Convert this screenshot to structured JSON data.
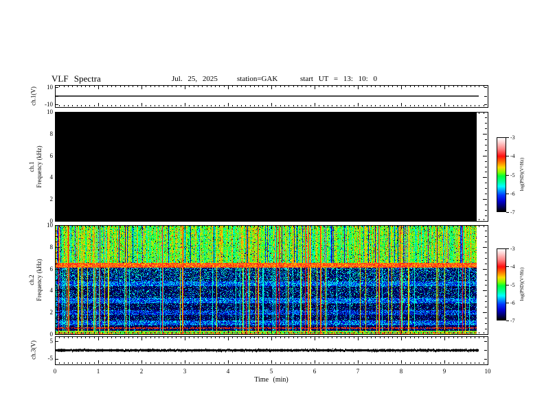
{
  "header": {
    "title": "VLF Spectra",
    "date": "Jul. 25, 2025",
    "station": "station=GAK",
    "start_ut": "start UT = 13: 10: 0"
  },
  "xaxis": {
    "label": "Time (min)",
    "ticks": [
      "0",
      "1",
      "2",
      "3",
      "4",
      "5",
      "6",
      "7",
      "8",
      "9",
      "10"
    ]
  },
  "panels": {
    "ch1v": {
      "label": "ch.1(V)",
      "yticks": [
        "10",
        "-10"
      ]
    },
    "ch1spec": {
      "label_line1": "ch.1",
      "label_line2": "Frequency (kHz)",
      "yticks": [
        "10",
        "8",
        "6",
        "4",
        "2",
        "0"
      ]
    },
    "ch2spec": {
      "label_line1": "ch.2",
      "label_line2": "Frequency (kHz)",
      "yticks": [
        "10",
        "8",
        "6",
        "4",
        "2",
        "0"
      ]
    },
    "ch3v": {
      "label": "ch.3(V)",
      "yticks": [
        "5",
        "-5"
      ]
    }
  },
  "colorbars": [
    {
      "label": "log(PSD)(V²/Hz)",
      "ticks": [
        "-3",
        "-4",
        "-5",
        "-6",
        "-7"
      ]
    },
    {
      "label": "log(PSD)(V²/Hz)",
      "ticks": [
        "-3",
        "-4",
        "-5",
        "-6",
        "-7"
      ]
    }
  ],
  "colors": {
    "scale": [
      [
        0,
        "#ffffff"
      ],
      [
        0.06,
        "#ffd2d2"
      ],
      [
        0.15,
        "#ff8484"
      ],
      [
        0.25,
        "#ff0e0e"
      ],
      [
        0.32,
        "#ff6a00"
      ],
      [
        0.4,
        "#ffd800"
      ],
      [
        0.47,
        "#7dff00"
      ],
      [
        0.52,
        "#00ff38"
      ],
      [
        0.6,
        "#00ff9c"
      ],
      [
        0.66,
        "#00ffff"
      ],
      [
        0.72,
        "#0096ff"
      ],
      [
        0.78,
        "#0038ff"
      ],
      [
        0.86,
        "#0000cf"
      ],
      [
        0.93,
        "#00006e"
      ],
      [
        1,
        "#000000"
      ]
    ],
    "frame": "#000000",
    "background": "#ffffff"
  },
  "chart_data": [
    {
      "type": "line",
      "name": "ch1_voltage",
      "ylabel": "ch.1(V)",
      "ylim": [
        -13,
        12.5
      ],
      "yticks": [
        10,
        -10
      ],
      "xlim": [
        0,
        10
      ],
      "x_extent": [
        0,
        9.8
      ],
      "series": [
        {
          "name": "ch.1",
          "y_constant": 0
        }
      ]
    },
    {
      "type": "heatmap",
      "name": "ch1_spectrogram",
      "ylabel": "ch.1 Frequency (kHz)",
      "ylim": [
        0,
        10
      ],
      "yticks": [
        0,
        2,
        4,
        6,
        8,
        10
      ],
      "xlim": [
        0,
        10
      ],
      "x_extent": [
        0,
        9.75
      ],
      "zlabel": "log(PSD)(V²/Hz)",
      "zlim": [
        -7,
        -3
      ],
      "uniform_level": -7
    },
    {
      "type": "heatmap",
      "name": "ch2_spectrogram",
      "ylabel": "ch.2 Frequency (kHz)",
      "ylim": [
        0,
        10
      ],
      "yticks": [
        0,
        2,
        4,
        6,
        8,
        10
      ],
      "xlim": [
        0,
        10
      ],
      "x_extent": [
        0,
        9.75
      ],
      "zlabel": "log(PSD)(V²/Hz)",
      "zlim": [
        -7,
        -3
      ],
      "bands": [
        {
          "f_range": [
            6.6,
            10.0
          ],
          "level": -4.95,
          "noise": 0.4,
          "kind": "bright"
        },
        {
          "f_range": [
            6.15,
            6.6
          ],
          "level": -4.2,
          "noise": 0.45,
          "kind": "bright"
        },
        {
          "f_range": [
            4.85,
            6.15
          ],
          "level": -6.6,
          "noise": 0.35,
          "kind": "dark",
          "dash_p": 0.38
        },
        {
          "f_range": [
            4.4,
            4.85
          ],
          "level": -6.05,
          "noise": 0.5,
          "kind": "mid"
        },
        {
          "f_range": [
            3.35,
            4.4
          ],
          "level": -6.65,
          "noise": 0.3,
          "kind": "dark",
          "dash_p": 0.25
        },
        {
          "f_range": [
            2.85,
            3.35
          ],
          "level": -6.1,
          "noise": 0.5,
          "kind": "mid"
        },
        {
          "f_range": [
            2.2,
            2.85
          ],
          "level": -6.7,
          "noise": 0.3,
          "kind": "dark",
          "dash_p": 0.2
        },
        {
          "f_range": [
            1.75,
            2.2
          ],
          "level": -6.3,
          "noise": 0.45,
          "kind": "mid"
        },
        {
          "f_range": [
            1.25,
            1.75
          ],
          "level": -6.7,
          "noise": 0.3,
          "kind": "dark",
          "dash_p": 0.18
        },
        {
          "f_range": [
            0.85,
            1.25
          ],
          "level": -6.1,
          "noise": 0.5,
          "kind": "mid"
        },
        {
          "f_range": [
            0.3,
            0.85
          ],
          "level": -6.85,
          "noise": 0.25,
          "kind": "dark",
          "dash_p": 0.12
        },
        {
          "f_range": [
            0.0,
            0.3
          ],
          "level": -4.9,
          "noise": 0.6,
          "kind": "bright"
        }
      ],
      "red_line_f": 0.56,
      "vertical_streaks": {
        "green_fraction": 0.06,
        "cyan_fraction": 0.04,
        "red_fraction": 0.012
      }
    },
    {
      "type": "line",
      "name": "ch3_voltage",
      "ylabel": "ch.3(V)",
      "ylim": [
        -8,
        7.7
      ],
      "yticks": [
        5,
        -5
      ],
      "xlim": [
        0,
        10
      ],
      "x_extent": [
        0,
        9.8
      ],
      "series": [
        {
          "name": "ch.3",
          "y_constant": 0,
          "appearance": "thick noisy trace"
        }
      ]
    }
  ]
}
